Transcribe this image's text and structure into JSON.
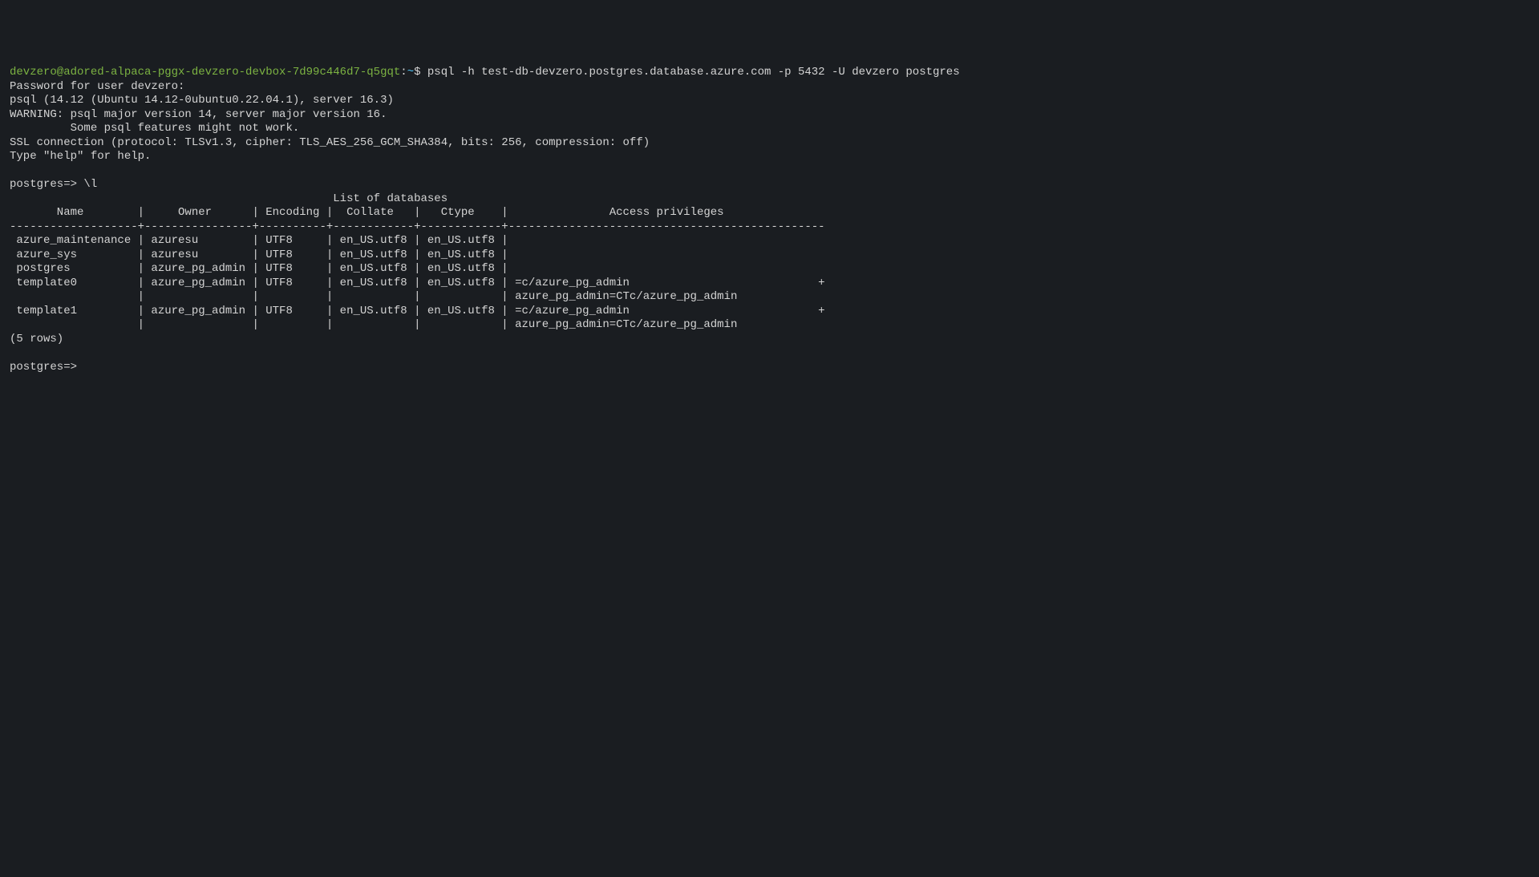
{
  "prompt": {
    "userhost": "devzero@adored-alpaca-pggx-devzero-devbox-7d99c446d7-q5gqt",
    "sep": ":",
    "path": "~",
    "dollar": "$ "
  },
  "command": "psql -h test-db-devzero.postgres.database.azure.com -p 5432 -U devzero postgres",
  "lines": {
    "password": "Password for user devzero: ",
    "version": "psql (14.12 (Ubuntu 14.12-0ubuntu0.22.04.1), server 16.3)",
    "warning1": "WARNING: psql major version 14, server major version 16.",
    "warning2": "         Some psql features might not work.",
    "ssl": "SSL connection (protocol: TLSv1.3, cipher: TLS_AES_256_GCM_SHA384, bits: 256, compression: off)",
    "help": "Type \"help\" for help.",
    "blank1": "",
    "psql_prompt1": "postgres=> \\l",
    "title": "                                                List of databases",
    "header": "       Name        |     Owner      | Encoding |  Collate   |   Ctype    |               Access privileges               ",
    "divider": "-------------------+----------------+----------+------------+------------+-----------------------------------------------",
    "row1": " azure_maintenance | azuresu        | UTF8     | en_US.utf8 | en_US.utf8 | ",
    "row2": " azure_sys         | azuresu        | UTF8     | en_US.utf8 | en_US.utf8 | ",
    "row3": " postgres          | azure_pg_admin | UTF8     | en_US.utf8 | en_US.utf8 | ",
    "row4": " template0         | azure_pg_admin | UTF8     | en_US.utf8 | en_US.utf8 | =c/azure_pg_admin                            +",
    "row4b": "                   |                |          |            |            | azure_pg_admin=CTc/azure_pg_admin",
    "row5": " template1         | azure_pg_admin | UTF8     | en_US.utf8 | en_US.utf8 | =c/azure_pg_admin                            +",
    "row5b": "                   |                |          |            |            | azure_pg_admin=CTc/azure_pg_admin",
    "count": "(5 rows)",
    "blank2": "",
    "psql_prompt2": "postgres=> "
  }
}
